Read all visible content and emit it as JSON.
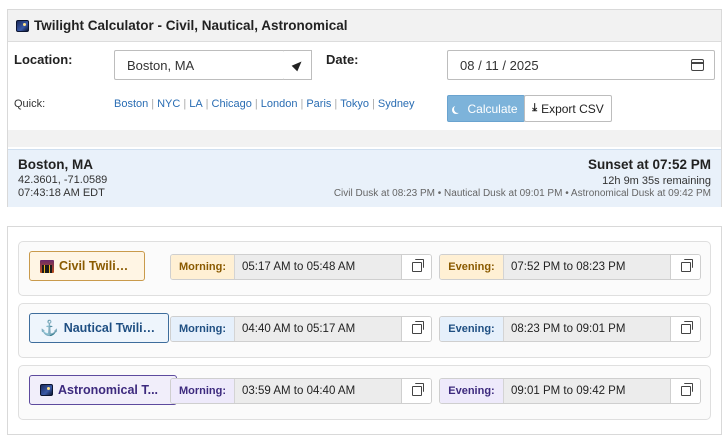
{
  "header": {
    "title": "Twilight Calculator - Civil, Nautical, Astronomical",
    "icon": "night-sky-icon"
  },
  "form": {
    "location_label": "Location:",
    "location_value": "Boston, MA",
    "date_label": "Date:",
    "date_value": "08 / 11 / 2025"
  },
  "quick": {
    "label": "Quick:",
    "links": [
      "Boston",
      "NYC",
      "LA",
      "Chicago",
      "London",
      "Paris",
      "Tokyo",
      "Sydney"
    ]
  },
  "buttons": {
    "calculate": "Calculate",
    "export": "Export CSV"
  },
  "status": {
    "city": "Boston, MA",
    "coords": "42.3601, -71.0589",
    "time": "07:43:18 AM EDT",
    "sunset": "Sunset at 07:52 PM",
    "remaining": "12h 9m 35s remaining",
    "dusk": "Civil Dusk at 08:23 PM • Nautical Dusk at 09:01 PM • Astronomical Dusk at 09:42 PM"
  },
  "twilights": [
    {
      "name": "Civil Twilight",
      "icon": "city-dusk-icon",
      "morning_label": "Morning:",
      "morning": "05:17 AM to 05:48 AM",
      "evening_label": "Evening:",
      "evening": "07:52 PM to 08:23 PM"
    },
    {
      "name": "Nautical Twilight",
      "icon": "anchor-icon",
      "morning_label": "Morning:",
      "morning": "04:40 AM to 05:17 AM",
      "evening_label": "Evening:",
      "evening": "08:23 PM to 09:01 PM"
    },
    {
      "name": "Astronomical T...",
      "icon": "night-sky-icon",
      "morning_label": "Morning:",
      "morning": "03:59 AM to 04:40 AM",
      "evening_label": "Evening:",
      "evening": "09:01 PM to 09:42 PM"
    }
  ],
  "colors": {
    "accent": "#2a6db3",
    "calc_button": "#7db3da",
    "status_bg": "#e9f1fa"
  }
}
